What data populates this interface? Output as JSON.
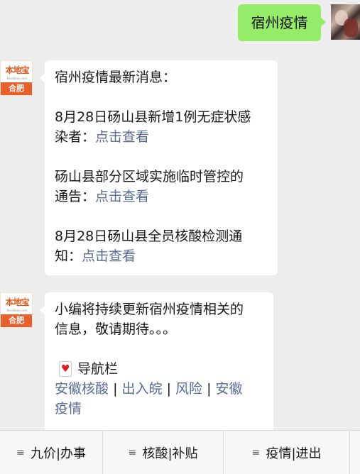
{
  "chat": {
    "outgoing": {
      "text": "宿州疫情"
    },
    "bot": {
      "logo_text": "本地宝",
      "logo_domain": "Bendibao.com",
      "city": "合肥"
    },
    "message1": {
      "heading": "宿州疫情最新消息：",
      "items": [
        {
          "text_line1": "8月28日砀山县新增1例无症状感",
          "text_line2": "染者：",
          "link": "点击查看"
        },
        {
          "text_line1": "砀山县部分区域实施临时管控的",
          "text_line2": "通告：",
          "link": "点击查看"
        },
        {
          "text_line1": "8月28日砀山县全员核酸检测通",
          "text_line2": "知：",
          "link": "点击查看"
        }
      ]
    },
    "message2": {
      "text_line1": "小编将持续更新宿州疫情相关的",
      "text_line2": "信息，敬请期待。。。",
      "nav_label": "导航栏",
      "nav_links": [
        "安徽核酸",
        "出入皖",
        "风险",
        "安徽",
        "疫情"
      ],
      "separator": "|"
    }
  },
  "bottom_menu": {
    "items": [
      "九价|办事",
      "核酸|补贴",
      "疫情|进出"
    ]
  }
}
